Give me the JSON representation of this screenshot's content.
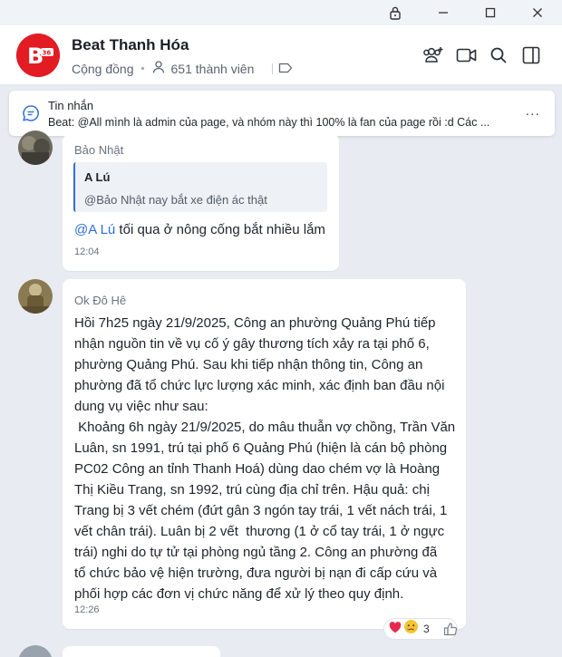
{
  "window": {
    "controls": [
      "lock-icon",
      "minimize-icon",
      "maximize-icon",
      "close-icon"
    ]
  },
  "header": {
    "title": "Beat Thanh Hóa",
    "community_label": "Cộng đồng",
    "members_text": "651 thành viên",
    "avatar_text": "B",
    "avatar_badge": "36",
    "icons": [
      "add-member-icon",
      "video-call-icon",
      "search-icon",
      "sidebar-toggle-icon"
    ]
  },
  "pinned": {
    "title": "Tin nhắn",
    "text": "Beat: @All  mình là admin của page, và nhóm này thì 100% là fan của page rồi :d  Các ...",
    "more": "..."
  },
  "messages": [
    {
      "sender": "Bảo Nhật",
      "quote_name": "A Lú",
      "quote_text": "@Bảo Nhật nay bắt xe điện ác thật",
      "mention": "@A Lú",
      "text": " tối qua ở nông cống bắt nhiều lắm",
      "time": "12:04"
    },
    {
      "sender": "Ok Đô Hê",
      "lines": [
        "Hồi 7h25 ngày 21/9/2025, Công an phường Quảng Phú tiếp",
        "nhận nguồn tin về vụ cố ý gây thương tích xảy ra tại phố 6,",
        "phường Quảng Phú. Sau khi tiếp nhận thông tin, Công an",
        "phường đã tổ chức lực lượng xác minh, xác định ban đầu nội",
        "dung vụ việc như sau:",
        " Khoảng 6h ngày 21/9/2025, do mâu thuẫn vợ chồng, Trần Văn",
        "Luân, sn 1991, trú tại phố 6 Quảng Phú (hiện là cán bộ phòng",
        "PC02 Công an tỉnh Thanh Hoá) dùng dao chém vợ là Hoàng",
        "Thị Kiều Trang, sn 1992, trú cùng địa chỉ trên. Hậu quả: chị",
        "Trang bị 3 vết chém (đứt gân 3 ngón tay trái, 1 vết nách trái, 1",
        "vết chân trái). Luân bị 2 vết  thương (1 ở cổ tay trái, 1 ở ngực",
        "trái) nghi do tự tử tại phòng ngủ tầng 2. Công an phường đã",
        "tổ chức bảo vệ hiện trường, đưa người bị nạn đi cấp cứu và",
        "phối hợp các đơn vị chức năng để xử lý theo quy định."
      ],
      "time": "12:26",
      "reactions": {
        "emojis": [
          "❤️",
          "😢"
        ],
        "count": "3"
      }
    }
  ],
  "colors": {
    "brand_red": "#e31b23",
    "accent_blue": "#2f6fd6",
    "background": "#e8ecf2"
  }
}
